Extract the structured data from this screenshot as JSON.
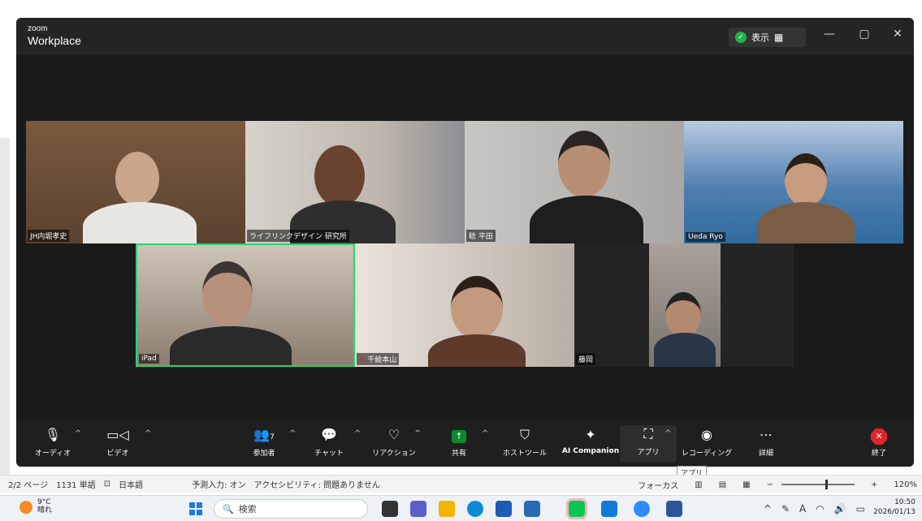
{
  "zoom": {
    "brand_small": "zoom",
    "brand_large": "Workplace",
    "view_label": "表示",
    "window_controls": [
      "minimize-icon",
      "maximize-icon",
      "close-icon"
    ]
  },
  "participants": [
    {
      "name": "JH内堀孝史"
    },
    {
      "name": "ライフリンクデザイン 研究所"
    },
    {
      "name": "稔 平田"
    },
    {
      "name": "Ueda Ryo"
    },
    {
      "name": "iPad"
    },
    {
      "name": "千絵本山"
    },
    {
      "name": "藤岡"
    }
  ],
  "toolbar": {
    "audio": "オーディオ",
    "video": "ビデオ",
    "participants": "参加者",
    "participants_count": "7",
    "chat": "チャット",
    "reaction": "リアクション",
    "share": "共有",
    "host_tools": "ホストツール",
    "ai": "AI Companion",
    "apps": "アプリ",
    "recording": "レコーディング",
    "more": "詳細",
    "end": "終了",
    "tooltip": "アプリ",
    "share_color": "#0b8a2b",
    "end_color": "#e0242c"
  },
  "word_status": {
    "page": "2/2 ページ",
    "words": "1131 単語",
    "language": "日本語",
    "predict": "予測入力: オン",
    "accessibility": "アクセシビリティ: 問題ありません",
    "focus": "フォーカス",
    "zoom": "120%"
  },
  "taskbar": {
    "temp": "9°C",
    "weather": "晴れ",
    "search": "検索",
    "time": "10:50",
    "date": "2026/01/13"
  }
}
